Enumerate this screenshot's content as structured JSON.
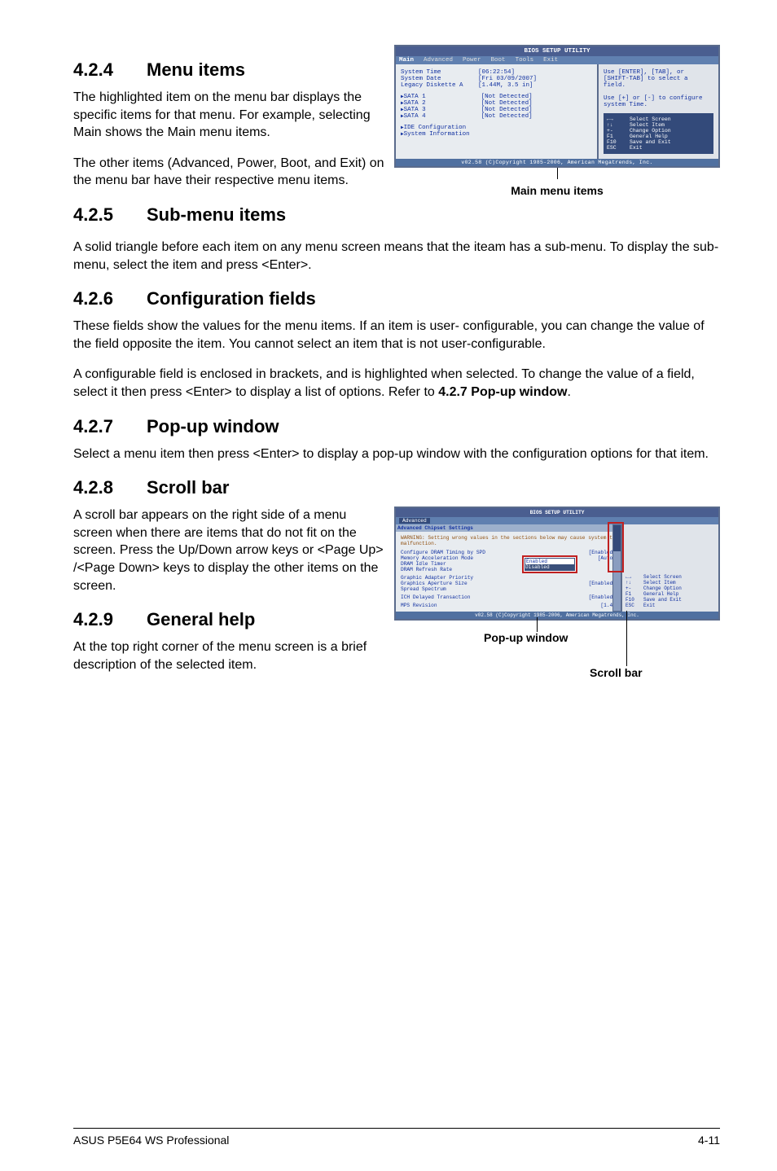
{
  "sections": {
    "s424": {
      "num": "4.2.4",
      "title": "Menu items",
      "p1": "The highlighted item on the menu bar displays the specific items for that menu. For example, selecting Main shows the Main menu items.",
      "p2": "The other items (Advanced, Power, Boot, and Exit) on the menu bar have their respective menu items."
    },
    "s425": {
      "num": "4.2.5",
      "title": "Sub-menu items",
      "p1": "A solid triangle before each item on any menu screen means that the iteam has a sub-menu. To display the sub-menu, select the item and press <Enter>."
    },
    "s426": {
      "num": "4.2.6",
      "title": "Configuration fields",
      "p1": "These fields show the values for the menu items. If an item is user- configurable, you can change the value of the field opposite the item. You cannot select an item that is not user-configurable.",
      "p2a": "A configurable field is enclosed in brackets, and is highlighted when selected. To change the value of a field, select it then press <Enter> to display a list of options. Refer to ",
      "p2b": "4.2.7 Pop-up window",
      "p2c": "."
    },
    "s427": {
      "num": "4.2.7",
      "title": "Pop-up window",
      "p1": "Select a menu item then press <Enter> to display a pop-up window with the configuration options for that item."
    },
    "s428": {
      "num": "4.2.8",
      "title": "Scroll bar",
      "p1": "A scroll bar appears on the right side of a menu screen when there are items that do not fit on the screen. Press the Up/Down arrow keys or <Page Up> /<Page Down> keys to display the other items on the screen."
    },
    "s429": {
      "num": "4.2.9",
      "title": "General help",
      "p1": "At the top right corner of the menu screen is a brief description of the selected item."
    }
  },
  "bios1": {
    "utility_title": "BIOS SETUP UTILITY",
    "tabs": [
      "Main",
      "Advanced",
      "Power",
      "Boot",
      "Tools",
      "Exit"
    ],
    "rows": [
      {
        "k": "System Time",
        "v": "[06:22:54]"
      },
      {
        "k": "System Date",
        "v": "[Fri 03/09/2007]"
      },
      {
        "k": "Legacy Diskette A",
        "v": "[1.44M, 3.5 in]"
      }
    ],
    "sata": [
      {
        "k": "SATA 1",
        "v": "[Not Detected]"
      },
      {
        "k": "SATA 2",
        "v": "[Not Detected]"
      },
      {
        "k": "SATA 3",
        "v": "[Not Detected]"
      },
      {
        "k": "SATA 4",
        "v": "[Not Detected]"
      }
    ],
    "subs": [
      "IDE Configuration",
      "System Information"
    ],
    "help_top": "Use [ENTER], [TAB], or [SHIFT-TAB] to select a field.\n\nUse [+] or [-] to configure system Time.",
    "help_nav": [
      {
        "k": "←→",
        "v": "Select Screen"
      },
      {
        "k": "↑↓",
        "v": "Select Item"
      },
      {
        "k": "+-",
        "v": "Change Option"
      },
      {
        "k": "F1",
        "v": "General Help"
      },
      {
        "k": "F10",
        "v": "Save and Exit"
      },
      {
        "k": "ESC",
        "v": "Exit"
      }
    ],
    "footer": "v02.58 (C)Copyright 1985-2006, American Megatrends, Inc.",
    "caption": "Main menu items"
  },
  "bios2": {
    "utility_title": "BIOS SETUP UTILITY",
    "tab": "Advanced",
    "header": "Advanced Chipset Settings",
    "warning": "WARNING: Setting wrong values in the sections below may cause system to malfunction.",
    "rows": [
      {
        "k": "Configure DRAM Timing by SPD",
        "v": "[Enabled]"
      },
      {
        "k": "Memory Acceleration Mode",
        "v": "[Auto]"
      },
      {
        "k": "DRAM Idle Timer",
        "v": ""
      },
      {
        "k": "DRAM Refresh Rate",
        "v": ""
      },
      {
        "k": "Graphic Adapter Priority",
        "v": ""
      },
      {
        "k": "Graphics Aperture Size",
        "v": "[Enabled]"
      },
      {
        "k": "Spread Spectrum",
        "v": ""
      },
      {
        "k": "ICH Delayed Transaction",
        "v": "[Enabled]"
      },
      {
        "k": "MPS Revision",
        "v": "[1.4]"
      }
    ],
    "popup": [
      "Enabled",
      "Disabled"
    ],
    "nav": [
      {
        "k": "←→",
        "v": "Select Screen"
      },
      {
        "k": "↑↓",
        "v": "Select Item"
      },
      {
        "k": "+-",
        "v": "Change Option"
      },
      {
        "k": "F1",
        "v": "General Help"
      },
      {
        "k": "F10",
        "v": "Save and Exit"
      },
      {
        "k": "ESC",
        "v": "Exit"
      }
    ],
    "footer": "v02.58 (C)Copyright 1985-2006, American Megatrends, Inc.",
    "caption_popup": "Pop-up window",
    "caption_scroll": "Scroll bar"
  },
  "footer": {
    "left": "ASUS P5E64 WS Professional",
    "right": "4-11"
  }
}
